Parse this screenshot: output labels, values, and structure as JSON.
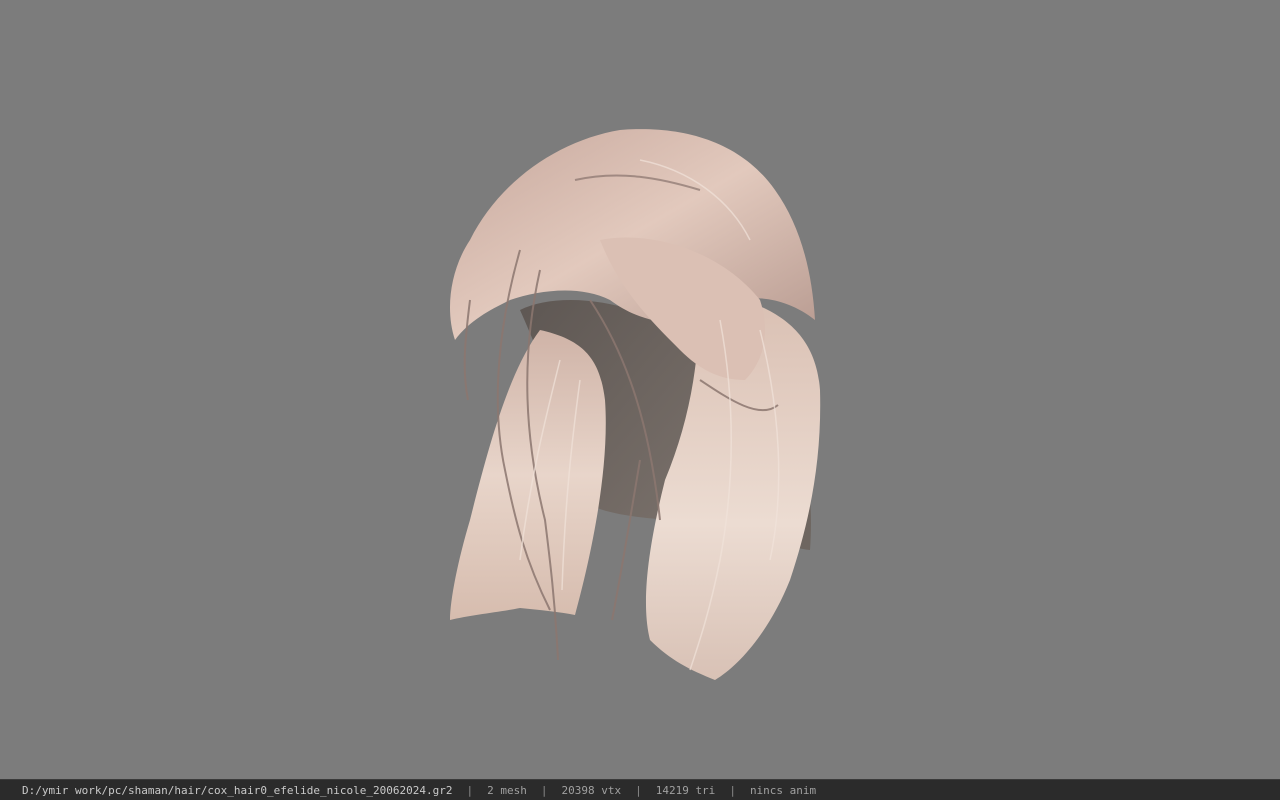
{
  "status": {
    "file_path": "D:/ymir work/pc/shaman/hair/cox_hair0_efelide_nicole_20062024.gr2",
    "separator": "|",
    "mesh": "2 mesh",
    "vertices": "20398 vtx",
    "triangles": "14219 tri",
    "anim": "nincs anim"
  },
  "colors": {
    "viewport_bg": "#7c7c7c",
    "statusbar_bg": "#2b2b2b",
    "hair_light": "#e8d3c7",
    "hair_mid": "#c9aea3",
    "hair_dark": "#6f6660"
  }
}
